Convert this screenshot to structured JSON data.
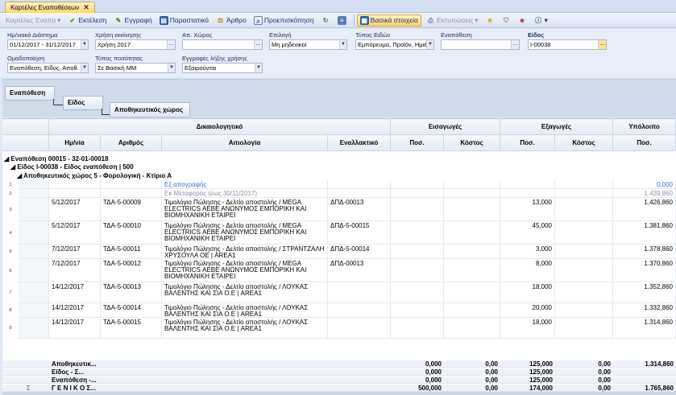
{
  "tab": {
    "title": "Καρτέλες Εναποθέσεων"
  },
  "toolbar": {
    "items": [
      {
        "label": "Καρτέλες Εναπο",
        "icon": "caret-down",
        "dim": true
      },
      {
        "label": "Εκτέλεση",
        "icon": "check-icon"
      },
      {
        "label": "Εγγραφή",
        "icon": "pen-icon"
      },
      {
        "label": "Παραστατικό",
        "icon": "document-icon"
      },
      {
        "label": "Άρθρο",
        "icon": "scales-icon"
      },
      {
        "label": "Προεπισκόπηση",
        "icon": "preview-icon"
      },
      {
        "label": "Βασικά στοιχεία",
        "icon": "grid-icon",
        "active": true
      },
      {
        "label": "Εκτυπώσεις",
        "icon": "print-icon",
        "dim": true
      }
    ]
  },
  "filters": {
    "period": {
      "label": "Ημ/νιακό Διάστημα",
      "value": "01/12/2017 - 31/12/2017"
    },
    "fiscal_year": {
      "label": "Χρήση εκκίνησης",
      "value": "Χρήση 2017"
    },
    "warehouse": {
      "label": "Απ. Χώρος",
      "value": ""
    },
    "option": {
      "label": "Επιλογή",
      "value": "Μη μηδενικοί"
    },
    "item_type": {
      "label": "Τύπος Ειδών",
      "value": "Εμπόρευμα, Προϊόν, Ημιέτ"
    },
    "deposit": {
      "label": "Εναπόθεση",
      "value": ""
    },
    "item": {
      "label": "Είδος",
      "value": "Ι-00038"
    },
    "grouping": {
      "label": "Ομαδοποίηση",
      "value": "Εναπόθεση, Είδος, Αποθ. Χ"
    },
    "qty_type": {
      "label": "Τύπος ποσότητας",
      "value": "Σε Βασική ΜΜ"
    },
    "closing": {
      "label": "Εγγραφές λήξης χρήσης",
      "value": "Εξαιρούνται"
    }
  },
  "group_panel": {
    "level1": "Εναπόθεση",
    "level2": "Είδος",
    "level3": "Αποθηκευτικός χώρος"
  },
  "columns": {
    "group_doc": "Δικαιολογητικό",
    "group_in": "Εισαγωγές",
    "group_out": "Εξαγωγές",
    "group_bal": "Υπόλοιπο",
    "date": "Ημ/νία",
    "number": "Αριθμός",
    "reason": "Αιτιολογία",
    "alt": "Εναλλακτικό",
    "in_qty": "Ποσ.",
    "in_cost": "Κόστος",
    "out_qty": "Ποσ.",
    "out_cost": "Κόστος",
    "bal_qty": "Ποσ."
  },
  "groups": {
    "g1": "Εναπόθεση  00015 - 32-01-00018",
    "g2": "Είδος  Ι-00038 - Είδος εναπόθεση | 500",
    "g3": "Αποθηκευτικός χώρος  5 - Φορολογική - Κτίριο Α"
  },
  "rows": [
    {
      "n": "1",
      "date": "",
      "number": "",
      "reason": "Εξ απογραφής",
      "alt": "",
      "in_qty": "",
      "in_cost": "",
      "out_qty": "",
      "out_cost": "",
      "bal": "0,000",
      "blue": true
    },
    {
      "n": "2",
      "date": "",
      "number": "",
      "reason": "Εκ Μεταφοράς (έως 30/11/2017)",
      "alt": "",
      "in_qty": "",
      "in_cost": "",
      "out_qty": "",
      "out_cost": "",
      "bal": "1.439,860",
      "grey": true
    },
    {
      "n": "3",
      "date": "5/12/2017",
      "number": "ΤΔΑ-5-00009",
      "reason": "Τιμολόγιο Πώλησης - Δελτίο αποστολής / MEGA ELECTRICS ΑΕΒΕ ΑΝΩΝΥΜΟΣ ΕΜΠΟΡΙΚΗ ΚΑΙ ΒΙΟΜΗΧΑΝΙΚΗ ΕΤΑΙΡΕΙ",
      "alt": "ΔΠΔ-00013",
      "in_qty": "",
      "in_cost": "",
      "out_qty": "13,000",
      "out_cost": "",
      "bal": "1.426,860"
    },
    {
      "n": "4",
      "date": "5/12/2017",
      "number": "ΤΔΑ-5-00010",
      "reason": "Τιμολόγιο Πώλησης - Δελτίο αποστολής / MEGA ELECTRICS ΑΕΒΕ ΑΝΩΝΥΜΟΣ ΕΜΠΟΡΙΚΗ ΚΑΙ ΒΙΟΜΗΧΑΝΙΚΗ ΕΤΑΙΡΕΙ",
      "alt": "ΔΠΔ-5-00015",
      "in_qty": "",
      "in_cost": "",
      "out_qty": "45,000",
      "out_cost": "",
      "bal": "1.381,860"
    },
    {
      "n": "5",
      "date": "7/12/2017",
      "number": "ΤΔΑ-5-00011",
      "reason": "Τιμολόγιο Πώλησης - Δελτίο αποστολής / ΣΤΡΑΝΤΖΑΛΗ ΧΡΥΣΟΥΛΑ  ΟΕ      | AREA1",
      "alt": "ΔΠΔ-5-00014",
      "in_qty": "",
      "in_cost": "",
      "out_qty": "3,000",
      "out_cost": "",
      "bal": "1.378,860"
    },
    {
      "n": "6",
      "date": "7/12/2017",
      "number": "ΤΔΑ-5-00012",
      "reason": "Τιμολόγιο Πώλησης - Δελτίο αποστολής / MEGA ELECTRICS ΑΕΒΕ ΑΝΩΝΥΜΟΣ ΕΜΠΟΡΙΚΗ ΚΑΙ ΒΙΟΜΗΧΑΝΙΚΗ ΕΤΑΙΡΕΙ",
      "alt": "ΔΠΔ-00013",
      "in_qty": "",
      "in_cost": "",
      "out_qty": "8,000",
      "out_cost": "",
      "bal": "1.370,860"
    },
    {
      "n": "7",
      "date": "14/12/2017",
      "number": "ΤΔΑ-5-00013",
      "reason": "Τιμολόγιο Πώλησης - Δελτίο αποστολής / ΛΟΥΚΑΣ ΒΑΛΕΝΤΗΣ ΚΑΙ ΣΙΑ Ο.Ε          | AREA1",
      "alt": "",
      "in_qty": "",
      "in_cost": "",
      "out_qty": "18,000",
      "out_cost": "",
      "bal": "1.352,860"
    },
    {
      "n": "8",
      "date": "14/12/2017",
      "number": "ΤΔΑ-5-00014",
      "reason": "Τιμολόγιο Πώλησης - Δελτίο αποστολής / ΛΟΥΚΑΣ ΒΑΛΕΝΤΗΣ ΚΑΙ ΣΙΑ Ο.Ε          | AREA1",
      "alt": "",
      "in_qty": "",
      "in_cost": "",
      "out_qty": "20,000",
      "out_cost": "",
      "bal": "1.332,860"
    },
    {
      "n": "9",
      "date": "14/12/2017",
      "number": "ΤΔΑ-5-00015",
      "reason": "Τιμολόγιο Πώλησης - Δελτίο αποστολής / ΛΟΥΚΑΣ ΒΑΛΕΝΤΗΣ ΚΑΙ ΣΙΑ Ο.Ε          | AREA1",
      "alt": "",
      "in_qty": "",
      "in_cost": "",
      "out_qty": "18,000",
      "out_cost": "",
      "bal": "1.314,860"
    }
  ],
  "footers": [
    {
      "label": "Αποθηκευτικ...",
      "in_qty": "0,000",
      "in_cost": "0,00",
      "out_qty": "125,000",
      "out_cost": "0,00",
      "bal": "1.314,860"
    },
    {
      "label": "Είδος     - Σ...",
      "in_qty": "0,000",
      "in_cost": "0,00",
      "out_qty": "125,000",
      "out_cost": "0,00",
      "bal": ""
    },
    {
      "label": "Εναπόθεση -...",
      "in_qty": "0,000",
      "in_cost": "0,00",
      "out_qty": "125,000",
      "out_cost": "0,00",
      "bal": ""
    },
    {
      "label": "Γ Ε Ν Ι Κ Ο  Σ...",
      "in_qty": "500,000",
      "in_cost": "0,00",
      "out_qty": "174,000",
      "out_cost": "0,00",
      "bal": "1.765,860"
    }
  ],
  "colors": {
    "accent": "#ffd66b",
    "link_blue": "#3a6fd8",
    "header_bg": "#e4ebf5"
  }
}
